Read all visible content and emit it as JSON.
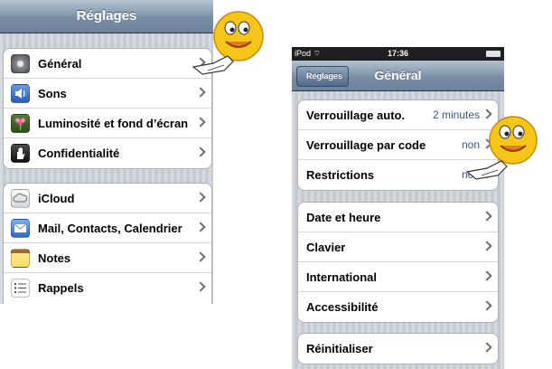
{
  "left_panel": {
    "nav_title": "Réglages",
    "group1": [
      {
        "label": "Général",
        "icon": "gear-icon"
      },
      {
        "label": "Sons",
        "icon": "speaker-icon"
      },
      {
        "label": "Luminosité et fond d’écran",
        "icon": "flower-icon"
      },
      {
        "label": "Confidentialité",
        "icon": "hand-icon"
      }
    ],
    "group2": [
      {
        "label": "iCloud",
        "icon": "cloud-icon"
      },
      {
        "label": "Mail, Contacts, Calendrier",
        "icon": "mail-icon"
      },
      {
        "label": "Notes",
        "icon": "notes-icon"
      },
      {
        "label": "Rappels",
        "icon": "reminders-icon"
      }
    ]
  },
  "right_panel": {
    "status": {
      "carrier": "iPod",
      "time": "17:36"
    },
    "back_label": "Réglages",
    "nav_title": "Général",
    "group1": [
      {
        "label": "Verrouillage auto.",
        "value": "2 minutes"
      },
      {
        "label": "Verrouillage par code",
        "value": "non"
      },
      {
        "label": "Restrictions",
        "value": "non"
      }
    ],
    "group2": [
      {
        "label": "Date et heure"
      },
      {
        "label": "Clavier"
      },
      {
        "label": "International"
      },
      {
        "label": "Accessibilité"
      }
    ],
    "group3": [
      {
        "label": "Réinitialiser"
      }
    ]
  },
  "colors": {
    "nav": "#7a8fa6",
    "value_text": "#385487",
    "smiley": "#f5c518"
  }
}
